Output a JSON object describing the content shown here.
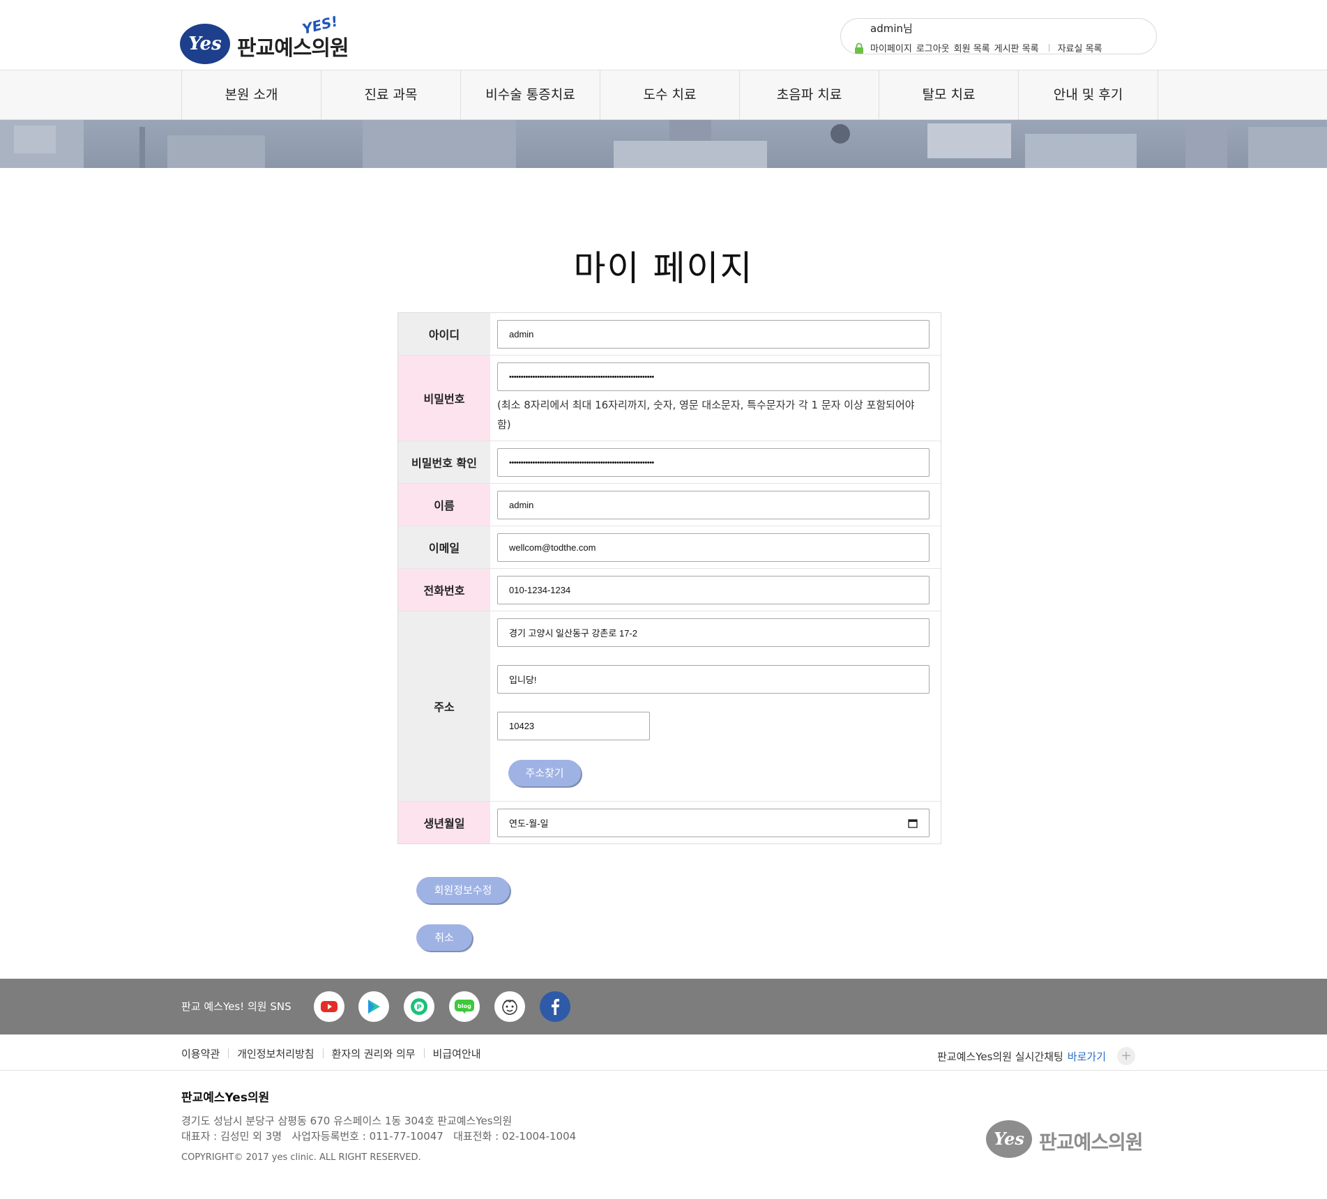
{
  "header": {
    "logo_badge": "Yes",
    "logo_text": "판교예스의원",
    "logo_yes": "YES!",
    "username": "admin님",
    "user_links": [
      "마이페이지",
      "로그아웃",
      "회원 목록",
      "게시판 목록"
    ],
    "user_link_extra": "자료실 목록"
  },
  "nav": {
    "items": [
      "본원 소개",
      "진료 과목",
      "비수술 통증치료",
      "도수 치료",
      "초음파 치료",
      "탈모 치료",
      "안내 및 후기"
    ]
  },
  "page": {
    "title": "마이 페이지"
  },
  "form": {
    "id_label": "아이디",
    "id_value": "admin",
    "pw_label": "비밀번호",
    "pw_value": "••••••••••••••••••••••••••••••••••••••••••••••••••••••••••••••",
    "pw_hint": "(최소 8자리에서 최대 16자리까지, 숫자, 영문 대소문자, 특수문자가 각 1 문자 이상 포함되어야 함)",
    "pw_confirm_label": "비밀번호 확인",
    "pw_confirm_value": "••••••••••••••••••••••••••••••••••••••••••••••••••••••••••••••",
    "name_label": "이름",
    "name_value": "admin",
    "email_label": "이메일",
    "email_value": "wellcom@todthe.com",
    "phone_label": "전화번호",
    "phone_value": "010-1234-1234",
    "address_label": "주소",
    "address_value": "경기 고양시 일산동구 강촌로 17-2",
    "address_detail_value": "입니당!",
    "zipcode_value": "10423",
    "find_address_button": "주소찾기",
    "birth_label": "생년월일",
    "birth_placeholder": "연도-월-일"
  },
  "actions": {
    "update_button": "회원정보수정",
    "cancel_button": "취소"
  },
  "footer": {
    "sns_label": "판교 예스Yes! 의원 SNS",
    "sns_icons": [
      "youtube-icon",
      "play-icon",
      "naver-post-icon",
      "blog-icon",
      "kakao-character-icon",
      "facebook-icon"
    ],
    "sns_blog_text": "blog",
    "links": [
      "이용약관",
      "개인정보처리방침",
      "환자의 권리와 의무",
      "비급여안내"
    ],
    "chat_text": "판교예스Yes의원 실시간채팅",
    "chat_link": "바로가기",
    "plus": "+",
    "clinic_name": "판교예스Yes의원",
    "address_line": "경기도 성남시 분당구 삼평동 670 유스페이스 1동 304호 판교예스Yes의원",
    "rep_line": "대표자 : 김성민 외 3명   사업자등록번호 : 011-77-10047   대표전화 : 02-1004-1004",
    "copyright": "COPYRIGHT© 2017 yes clinic. ALL RIGHT RESERVED.",
    "logo_badge": "Yes",
    "logo_text": "판교예스의원"
  },
  "colors": {
    "label_gray": "#eeeeee",
    "label_pink": "#fde3ee",
    "button_blue": "#9fb2e4",
    "sns_bar": "#7d7d7d",
    "brand_navy": "#1d3f8c"
  }
}
